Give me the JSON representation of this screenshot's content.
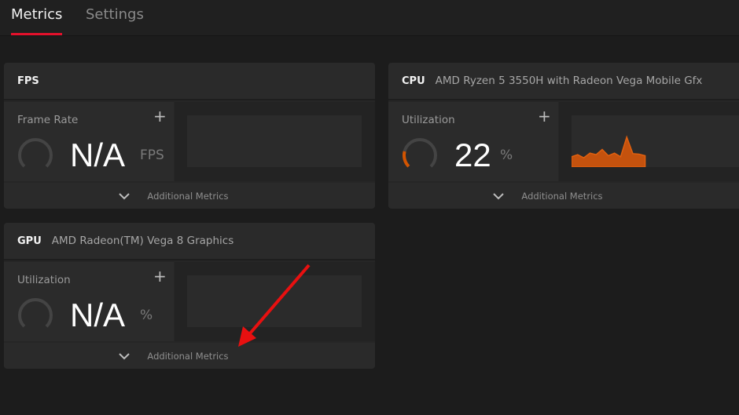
{
  "tabs": [
    {
      "label": "Metrics",
      "active": true
    },
    {
      "label": "Settings",
      "active": false
    }
  ],
  "colors": {
    "accent": "#e4112c",
    "cpu": "#d35400",
    "annotation": "#e81010"
  },
  "cards": {
    "fps": {
      "title": "FPS",
      "subtitle": "",
      "metric_label": "Frame Rate",
      "value": "N/A",
      "unit": "FPS",
      "gauge_fraction": 0,
      "footer": "Additional Metrics"
    },
    "cpu": {
      "title": "CPU",
      "subtitle": "AMD Ryzen 5 3550H with Radeon Vega Mobile Gfx",
      "metric_label": "Utilization",
      "value": "22",
      "unit": "%",
      "gauge_fraction": 0.22,
      "footer": "Additional Metrics"
    },
    "gpu": {
      "title": "GPU",
      "subtitle": "AMD Radeon(TM) Vega 8 Graphics",
      "metric_label": "Utilization",
      "value": "N/A",
      "unit": "%",
      "gauge_fraction": 0,
      "footer": "Additional Metrics"
    }
  },
  "chart_data": {
    "type": "area",
    "title": "CPU Utilization history",
    "ylabel": "%",
    "ylim": [
      0,
      100
    ],
    "values": [
      20,
      24,
      18,
      27,
      24,
      34,
      22,
      27,
      20,
      58,
      26,
      25,
      22
    ]
  }
}
